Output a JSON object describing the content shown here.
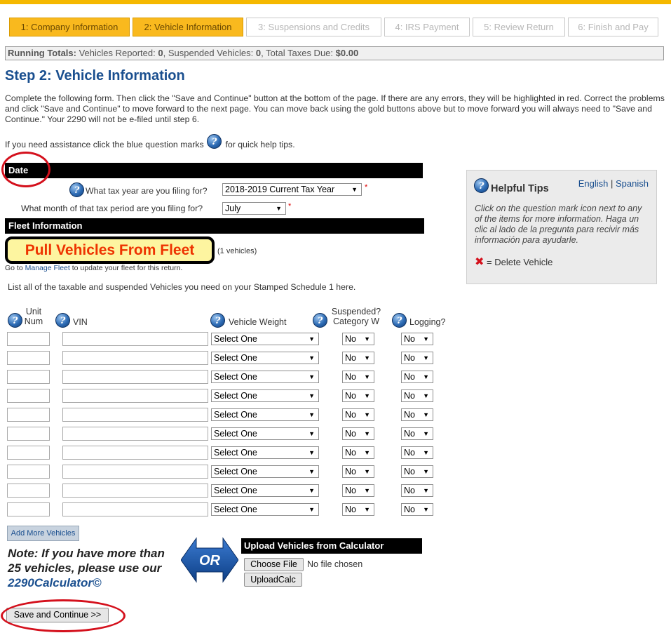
{
  "steps": [
    {
      "label": "1: Company Information",
      "active": true
    },
    {
      "label": "2: Vehicle Information",
      "active": true
    },
    {
      "label": "3: Suspensions and Credits",
      "active": false
    },
    {
      "label": "4: IRS Payment",
      "active": false
    },
    {
      "label": "5: Review Return",
      "active": false
    },
    {
      "label": "6: Finish and Pay",
      "active": false
    }
  ],
  "totals": {
    "label": "Running Totals:",
    "vehicles_label": "Vehicles Reported:",
    "vehicles_value": "0",
    "suspended_label": "Suspended Vehicles:",
    "suspended_value": "0",
    "taxes_label": "Total Taxes Due:",
    "taxes_value": "$0.00"
  },
  "page_title": "Step 2: Vehicle Information",
  "intro": "Complete the following form. Then click the \"Save and Continue\" button at the bottom of the page. If there are any errors, they will be highlighted in red. Correct the problems and click \"Save and Continue\" to move forward to the next page. You can move back using the gold buttons above but to move forward you will always need to \"Save and Continue.\" Your 2290 will not be e-filed until step 6.",
  "assist": {
    "before": "If you need assistance click the blue question marks",
    "after": "for quick help tips."
  },
  "date_section": {
    "title": "Date",
    "tax_year_label": "What tax year are you filing for?",
    "tax_year_value": "2018-2019 Current Tax Year",
    "month_label": "What month of that tax period are you filing for?",
    "month_value": "July"
  },
  "fleet_section": {
    "title": "Fleet Information",
    "pull_button": "Pull Vehicles From Fleet",
    "vehicle_count": "(1 vehicles)",
    "goto_before": "Go to",
    "goto_link": "Manage Fleet",
    "goto_after": "to update your fleet for this return.",
    "list_text": "List all of the taxable and suspended Vehicles you need on your Stamped Schedule 1 here."
  },
  "columns": {
    "unit_num": "Unit Num",
    "vin": "VIN",
    "weight": "Vehicle Weight",
    "suspended": "Suspended? Category W",
    "logging": "Logging?"
  },
  "row_defaults": {
    "weight": "Select One",
    "suspended": "No",
    "logging": "No"
  },
  "row_count": 10,
  "add_more": "Add More Vehicles",
  "note": {
    "text": "Note: If you have more than 25 vehicles, please use our",
    "calc": "2290Calculator©"
  },
  "or_text": "OR",
  "upload": {
    "title": "Upload Vehicles from Calculator",
    "choose_file": "Choose File",
    "no_file": "No file chosen",
    "upload_calc": "UploadCalc"
  },
  "save_button": "Save and Continue >>",
  "tips": {
    "title": "Helpful Tips",
    "english": "English",
    "separator": "|",
    "spanish": "Spanish",
    "body": "Click on the question mark icon next to any of the items for more information. Haga un clic al lado de la pregunta para recivir más información para ayudarle.",
    "delete_label": "= Delete Vehicle"
  },
  "icon_help": "?",
  "icon_delete": "✖",
  "required_mark": "*",
  "colors": {
    "gold": "#f9b91e",
    "title_blue": "#1a4f8f",
    "red": "#d4101c"
  }
}
